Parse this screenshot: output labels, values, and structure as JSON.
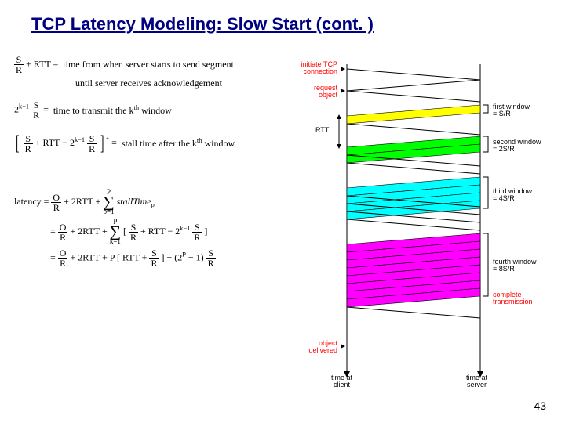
{
  "title": "TCP Latency Modeling: Slow Start (cont. )",
  "page_number": "43",
  "eq1_pre": " + RTT = ",
  "eq1_desc": "time from when server starts to send segment",
  "eq1_desc2": "until server receives acknowledgement",
  "eq2_coef": "2",
  "eq2_exp": "k−1",
  "eq2_eq": " = ",
  "eq2_desc": "time to transmit the k",
  "eq2_th": "th",
  "eq2_desc2": " window",
  "eq3_plus": "⁺",
  "eq3_eq": " = ",
  "eq3_desc": "stall time after the k",
  "eq3_th": "th",
  "eq3_desc2": " window",
  "lat_label": "latency = ",
  "lat1_a": " + 2RTT + ",
  "lat1_sum_top": "P",
  "lat1_sum_bot": "p=1",
  "lat1_tail": "stallTime",
  "lat1_sub": "p",
  "lat2_a": " + 2RTT + ",
  "lat2_sum_top": "P",
  "lat2_sum_bot": "k=1",
  "lat2_inner1": " + RTT − 2",
  "lat2_inner_exp": "k−1",
  "lat3_a": " + 2RTT + P",
  "lat3_inner1": "RTT + ",
  "lat3_mid": " − (2",
  "lat3_exp": "P",
  "lat3_mid2": " − 1)",
  "eq_start": " = ",
  "frac_S": "S",
  "frac_R": "R",
  "frac_O": "O",
  "diagram": {
    "initiate": "initiate TCP\nconnection",
    "request": "request\nobject",
    "rtt": "RTT",
    "delivered": "object\ndelivered",
    "time_client": "time at\nclient",
    "time_server": "time at\nserver",
    "complete": "complete\ntransmission",
    "w1": "first window\n= S/R",
    "w2": "second window\n= 2S/R",
    "w3": "third window\n= 4S/R",
    "w4": "fourth window\n= 8S/R"
  },
  "chart_data": {
    "type": "timing-diagram",
    "title": "TCP Slow Start timing",
    "windows": [
      {
        "name": "first window",
        "size": "S/R",
        "segments": 1,
        "color": "#ffff00"
      },
      {
        "name": "second window",
        "size": "2S/R",
        "segments": 2,
        "color": "#00ff00"
      },
      {
        "name": "third window",
        "size": "4S/R",
        "segments": 4,
        "color": "#00ffff"
      },
      {
        "name": "fourth window",
        "size": "8S/R",
        "segments": 8,
        "color": "#ff00ff"
      }
    ],
    "annotations": [
      "initiate TCP connection",
      "request object",
      "RTT",
      "object delivered",
      "complete transmission",
      "time at client",
      "time at server"
    ]
  }
}
